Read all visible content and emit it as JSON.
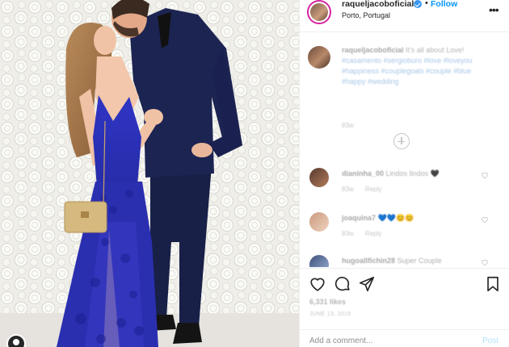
{
  "header": {
    "username": "raqueljacoboficial",
    "separator": "•",
    "follow_label": "Follow",
    "location": "Porto, Portugal",
    "more_icon": "more-horizontal-icon"
  },
  "caption": {
    "username": "raqueljacoboficial",
    "text": "It's all about Love!",
    "hashtags": "#casamento #sergioburo #love #loveyou #happiness #couplegoals #couple #blue #happy #wedding",
    "time": "83w"
  },
  "comments": [
    {
      "username": "dianinha_00",
      "text": "Lindos lindos 🖤",
      "time": "83w",
      "reply": "Reply"
    },
    {
      "username": "joaquina7",
      "text": "💙💙😊😊",
      "time": "83w",
      "reply": "Reply"
    },
    {
      "username": "hugoallfichin28",
      "text": "Super Couple",
      "time": "",
      "reply": ""
    }
  ],
  "actions": {
    "like_icon": "heart-icon",
    "comment_icon": "comment-icon",
    "share_icon": "paper-plane-icon",
    "save_icon": "bookmark-icon",
    "likes": "6,331 likes",
    "date": "JUNE 13, 2019"
  },
  "add_comment": {
    "placeholder": "Add a comment...",
    "post_label": "Post"
  },
  "colors": {
    "accent_blue": "#0095f6",
    "dress_blue": "#2a2fb0",
    "suit_navy": "#1c2452",
    "border": "#efefef"
  }
}
